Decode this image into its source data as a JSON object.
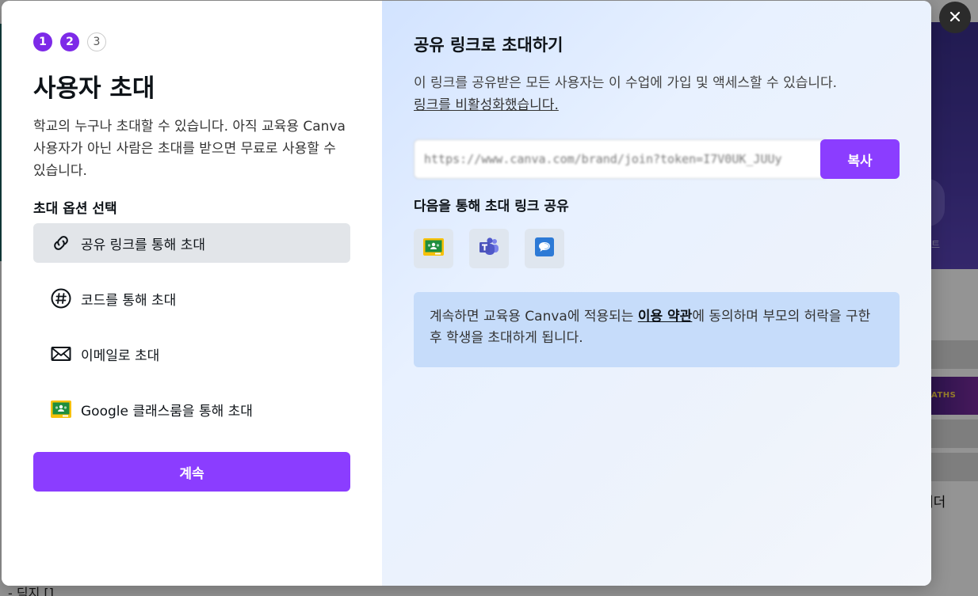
{
  "background": {
    "side_label": "트",
    "card_text": "ATHS",
    "bottom_right_label": "에더",
    "bottom_left_text": "- 딕지 []"
  },
  "dialog": {
    "steps": [
      {
        "number": "1",
        "state": "complete"
      },
      {
        "number": "2",
        "state": "current"
      },
      {
        "number": "3",
        "state": "upcoming"
      }
    ],
    "left": {
      "title": "사용자 초대",
      "description": "학교의 누구나 초대할 수 있습니다. 아직 교육용 Canva 사용자가 아닌 사람은 초대를 받으면 무료로 사용할 수 있습니다.",
      "options_heading": "초대 옵션 선택",
      "options": [
        {
          "label": "공유 링크를 통해 초대",
          "icon": "link-icon",
          "selected": true
        },
        {
          "label": "코드를 통해 초대",
          "icon": "hashtag-icon",
          "selected": false
        },
        {
          "label": "이메일로 초대",
          "icon": "envelope-icon",
          "selected": false
        },
        {
          "label": "Google 클래스룸을 통해 초대",
          "icon": "google-classroom-icon",
          "selected": false
        }
      ],
      "continue_label": "계속"
    },
    "right": {
      "title": "공유 링크로 초대하기",
      "description": "이 링크를 공유받은 모든 사용자는 이 수업에 가입 및 액세스할 수 있습니다.",
      "disable_link_label": "링크를 비활성화했습니다.",
      "invite_link_value": "https://www.canva.com/brand/join?token=I7V0UK_JUUy",
      "copy_label": "복사",
      "share_heading": "다음을 통해 초대 링크 공유",
      "share_targets": [
        {
          "name": "Google Classroom",
          "icon": "google-classroom-icon"
        },
        {
          "name": "Microsoft Teams",
          "icon": "microsoft-teams-icon"
        },
        {
          "name": "Remind",
          "icon": "remind-icon"
        }
      ],
      "notice": {
        "before": "계속하면 교육용 Canva에 적용되는 ",
        "terms_link": "이용 약관",
        "after": "에 동의하며 부모의 허락을 구한 후 학생을 초대하게 됩니다."
      }
    },
    "close_icon": "close-icon"
  },
  "colors": {
    "accent": "#8b3dff",
    "step_active": "#7d2ae8",
    "selected_option_bg": "#e2e5e9",
    "notice_bg": "#c6dcfa"
  }
}
